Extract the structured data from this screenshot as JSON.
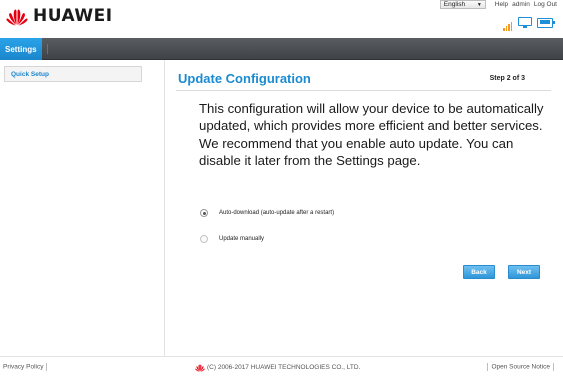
{
  "header": {
    "brand": "HUAWEI",
    "language": "English",
    "links": [
      "Help",
      "admin",
      "Log Out"
    ],
    "icons": [
      "signal-icon",
      "computer-icon",
      "battery-icon"
    ],
    "colors": {
      "logo_red": "#e60012",
      "accent_blue": "#1a8bd0",
      "signal_orange": "#f39a1e"
    }
  },
  "nav": {
    "settings_tab": "Settings"
  },
  "sidebar": {
    "items": [
      {
        "label": "Quick Setup"
      }
    ]
  },
  "main": {
    "title": "Update Configuration",
    "step": "Step 2 of 3",
    "description": "This configuration will allow your device to be automatically updated, which provides more efficient and better services. We recommend that you enable auto update. You can disable it later from the Settings page.",
    "options": [
      {
        "label": "Auto-download (auto-update after a restart)",
        "selected": true
      },
      {
        "label": "Update manually",
        "selected": false
      }
    ],
    "buttons": {
      "back": "Back",
      "next": "Next"
    }
  },
  "footer": {
    "privacy": "Privacy Policy",
    "copyright": "(C) 2006-2017 HUAWEI TECHNOLOGIES CO., LTD.",
    "open_source": "Open Source Notice"
  }
}
